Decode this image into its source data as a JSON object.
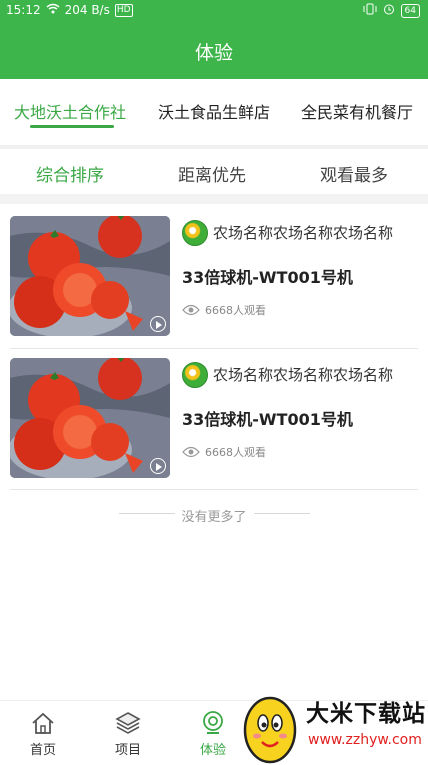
{
  "status_bar": {
    "time": "15:12",
    "net_speed": "204 B/s",
    "hd": "HD",
    "battery": "64"
  },
  "header": {
    "title": "体验"
  },
  "top_tabs": [
    {
      "label": "大地沃土合作社",
      "active": true
    },
    {
      "label": "沃土食品生鲜店",
      "active": false
    },
    {
      "label": "全民菜有机餐厅",
      "active": false
    }
  ],
  "sort_tabs": [
    {
      "label": "综合排序",
      "active": true
    },
    {
      "label": "距离优先",
      "active": false
    },
    {
      "label": "观看最多",
      "active": false
    }
  ],
  "cards": [
    {
      "farm_name": "农场名称农场名称农场名称",
      "device_title": "33倍球机-WT001号机",
      "views": "6668人观看"
    },
    {
      "farm_name": "农场名称农场名称农场名称",
      "device_title": "33倍球机-WT001号机",
      "views": "6668人观看"
    }
  ],
  "no_more_text": "没有更多了",
  "bottom_nav": [
    {
      "label": "首页",
      "icon": "home-icon",
      "active": false
    },
    {
      "label": "项目",
      "icon": "layers-icon",
      "active": false
    },
    {
      "label": "体验",
      "icon": "camera-icon",
      "active": true
    }
  ],
  "watermark": {
    "text": "大米下载站",
    "url": "www.zzhyw.com"
  },
  "colors": {
    "brand_green": "#3db54a",
    "active_text": "#3aa845"
  }
}
